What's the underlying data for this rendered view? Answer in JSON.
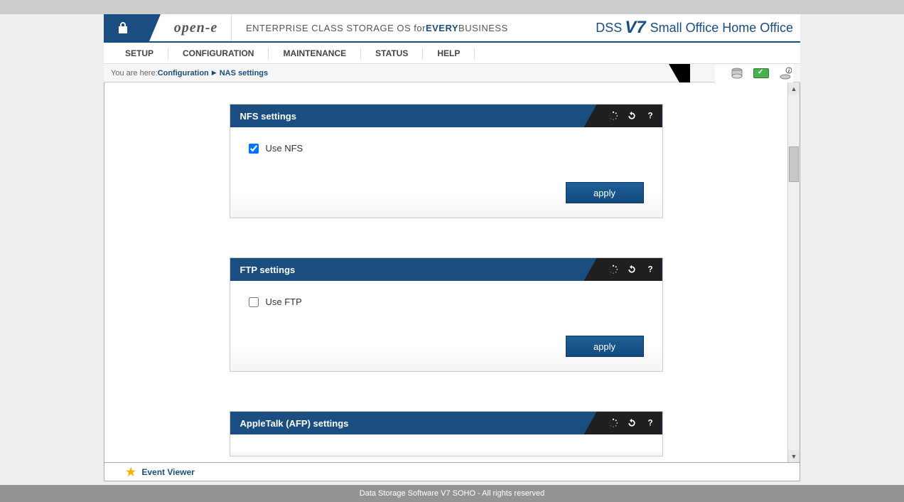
{
  "header": {
    "brand": "open-e",
    "tagline_a": "ENTERPRISE CLASS STORAGE OS for ",
    "tagline_b": "EVERY",
    "tagline_c": " BUSINESS",
    "product_dss": "DSS",
    "product_v7": "V7",
    "product_rest": "Small Office Home Office"
  },
  "nav": {
    "items": [
      "SETUP",
      "CONFIGURATION",
      "MAINTENANCE",
      "STATUS",
      "HELP"
    ]
  },
  "breadcrumb": {
    "prefix": "You are here: ",
    "a": "Configuration",
    "b": "NAS settings"
  },
  "panels": {
    "nfs": {
      "title": "NFS settings",
      "checkbox_label": "Use NFS",
      "checked": true,
      "apply": "apply"
    },
    "ftp": {
      "title": "FTP settings",
      "checkbox_label": "Use FTP",
      "checked": false,
      "apply": "apply"
    },
    "afp": {
      "title": "AppleTalk (AFP) settings"
    }
  },
  "eventbar": {
    "label": "Event Viewer"
  },
  "footer": {
    "text": "Data Storage Software V7 SOHO - All rights reserved"
  }
}
